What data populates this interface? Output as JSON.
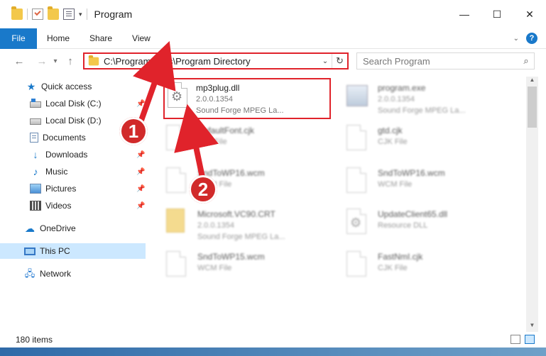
{
  "window": {
    "title": "Program",
    "minimize": "—",
    "maximize": "☐",
    "close": "✕"
  },
  "ribbon": {
    "file_tab": "File",
    "tabs": [
      "Home",
      "Share",
      "View"
    ]
  },
  "nav": {
    "back": "←",
    "forward": "→",
    "recent": "▾",
    "up": "↑",
    "address_path": "C:\\Program Files\\Program Directory",
    "refresh": "↻",
    "search_placeholder": "Search Program"
  },
  "sidebar": {
    "items": [
      {
        "label": "Quick access",
        "icon": "star-icon",
        "pinned": false
      },
      {
        "label": "Local Disk (C:)",
        "icon": "disk-icon",
        "pinned": true
      },
      {
        "label": "Local Disk (D:)",
        "icon": "disk-icon",
        "pinned": true
      },
      {
        "label": "Documents",
        "icon": "documents-icon",
        "pinned": true
      },
      {
        "label": "Downloads",
        "icon": "download-icon",
        "pinned": true
      },
      {
        "label": "Music",
        "icon": "music-icon",
        "pinned": true
      },
      {
        "label": "Pictures",
        "icon": "pictures-icon",
        "pinned": true
      },
      {
        "label": "Videos",
        "icon": "videos-icon",
        "pinned": true
      },
      {
        "label": "OneDrive",
        "icon": "cloud-icon",
        "pinned": false
      },
      {
        "label": "This PC",
        "icon": "computer-icon",
        "pinned": false,
        "selected": true
      },
      {
        "label": "Network",
        "icon": "network-icon",
        "pinned": false
      }
    ]
  },
  "files": [
    {
      "name": "mp3plug.dll",
      "line2": "2.0.0.1354",
      "line3": "Sound Forge MPEG La...",
      "icon": "gear-document-icon",
      "selected": true
    },
    {
      "name": "program.exe",
      "line2": "2.0.0.1354",
      "line3": "Sound Forge MPEG La...",
      "icon": "executable-icon"
    },
    {
      "name": "DefaultFont.cjk",
      "line2": "CJK File",
      "icon": "document-icon"
    },
    {
      "name": "gtd.cjk",
      "line2": "CJK File",
      "icon": "document-icon"
    },
    {
      "name": "SndToWP16.wcm",
      "line2": "WCM File",
      "icon": "document-icon"
    },
    {
      "name": "SndToWP16.wcm",
      "line2": "WCM File",
      "icon": "document-icon"
    },
    {
      "name": "Microsoft.VC90.CRT",
      "line2": "2.0.0.1354",
      "line3": "Sound Forge MPEG La...",
      "icon": "folder-icon"
    },
    {
      "name": "UpdateClient65.dll",
      "line2": "Resource DLL",
      "icon": "gear-document-icon"
    },
    {
      "name": "SndToWP15.wcm",
      "line2": "WCM File",
      "icon": "document-icon"
    },
    {
      "name": "FastNmI.cjk",
      "line2": "CJK File",
      "icon": "document-icon"
    }
  ],
  "status": {
    "item_count": "180 items"
  },
  "annotations": {
    "step1": "1",
    "step2": "2",
    "color": "#e0232b"
  },
  "colors": {
    "accent": "#1979ca",
    "highlight": "#e0232b",
    "selection": "#cce8ff"
  }
}
